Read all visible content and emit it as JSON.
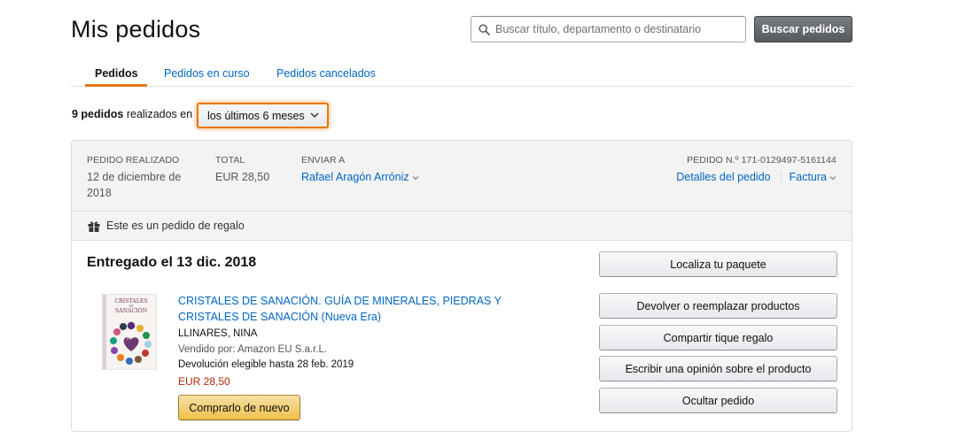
{
  "page": {
    "title": "Mis pedidos"
  },
  "search": {
    "placeholder": "Buscar título, departamento o destinatario",
    "button_label": "Buscar pedidos"
  },
  "tabs": [
    {
      "label": "Pedidos",
      "active": true
    },
    {
      "label": "Pedidos en curso",
      "active": false
    },
    {
      "label": "Pedidos cancelados",
      "active": false
    }
  ],
  "filter": {
    "count_text": "9 pedidos",
    "suffix_text": "realizados en",
    "range_value": "los últimos 6 meses"
  },
  "order": {
    "placed_label": "PEDIDO REALIZADO",
    "placed_date": "12 de diciembre de 2018",
    "total_label": "TOTAL",
    "total_value": "EUR 28,50",
    "ship_to_label": "ENVIAR A",
    "ship_to_name": "Rafael Aragón Arróniz",
    "order_number": "PEDIDO N.º 171-0129497-5161144",
    "details_link": "Detalles del pedido",
    "invoice_link": "Factura",
    "gift_text": "Este es un pedido de regalo",
    "status": "Entregado el 13 dic. 2018",
    "item": {
      "title": "CRISTALES DE SANACIÓN. GUÍA DE MINERALES, PIEDRAS Y CRISTALES DE SANACIÓN (Nueva Era)",
      "author": "LLINARES, NINA",
      "seller": "Vendido por: Amazon EU S.a.r.L.",
      "return_info": "Devolución elegible hasta 28 feb. 2019",
      "price": "EUR 28,50",
      "rebuy_label": "Comprarlo de nuevo",
      "cover_text_line1": "CRISTALES",
      "cover_text_line2": "DE",
      "cover_text_line3": "SANACIÓN"
    },
    "actions": [
      "Localiza tu paquete",
      "Devolver o reemplazar productos",
      "Compartir tique regalo",
      "Escribir una opinión sobre el producto",
      "Ocultar pedido"
    ]
  },
  "colors": {
    "link": "#0066c0",
    "accent_orange": "#e47911",
    "price_red": "#b12704",
    "rebuy_yellow": "#f0c14b"
  }
}
